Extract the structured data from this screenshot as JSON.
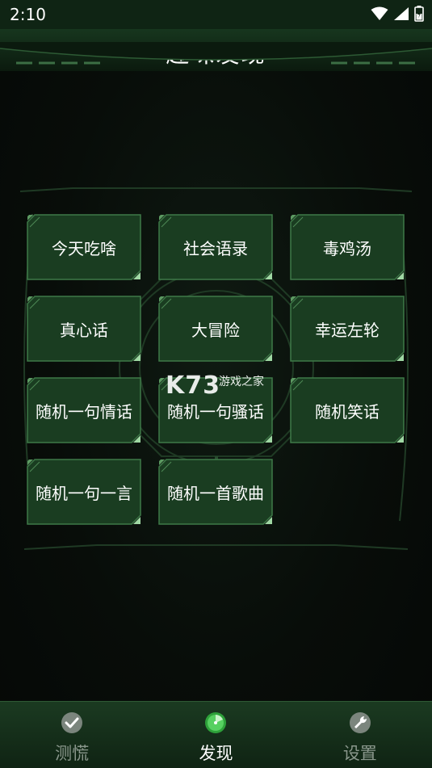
{
  "status_bar": {
    "time": "2:10",
    "icons": [
      "wifi-icon",
      "signal-icon",
      "battery-charging-icon"
    ]
  },
  "header": {
    "title": "趣味发现"
  },
  "tiles": [
    {
      "label": "今天吃啥"
    },
    {
      "label": "社会语录"
    },
    {
      "label": "毒鸡汤"
    },
    {
      "label": "真心话"
    },
    {
      "label": "大冒险"
    },
    {
      "label": "幸运左轮"
    },
    {
      "label": "随机一句情话"
    },
    {
      "label": "随机一句骚话"
    },
    {
      "label": "随机笑话"
    },
    {
      "label": "随机一句一言"
    },
    {
      "label": "随机一首歌曲"
    }
  ],
  "watermark": {
    "brand": "K73",
    "text": "游戏之家"
  },
  "bottom_nav": {
    "items": [
      {
        "label": "测慌",
        "icon": "check-circle-icon",
        "active": false
      },
      {
        "label": "发现",
        "icon": "radar-icon",
        "active": true
      },
      {
        "label": "设置",
        "icon": "wrench-icon",
        "active": false
      }
    ]
  },
  "colors": {
    "tile_fill": "#1a3d21",
    "tile_border": "#3e7a48",
    "accent_green": "#5bd35f",
    "nav_bg": "#1b3a21"
  }
}
